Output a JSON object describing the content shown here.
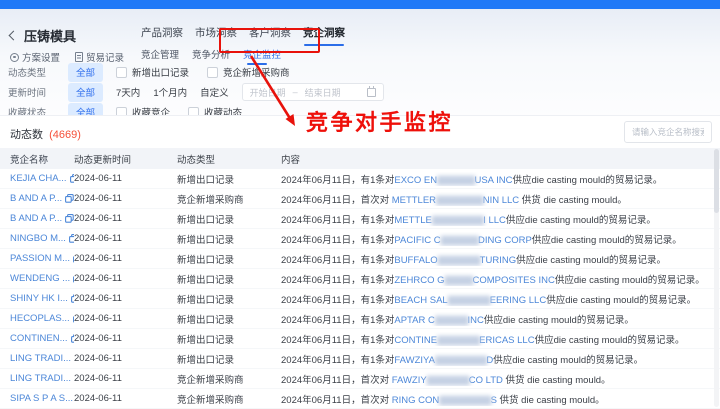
{
  "colors": {
    "accent_blue": "#2079f7",
    "tab_blue": "#2b6de8",
    "annotation_red": "#e8120b",
    "count_orange": "#f5503a",
    "link_blue": "#4c87d8",
    "pill_bg": "#dcebff"
  },
  "header": {
    "title": "压铸模具",
    "actions": [
      {
        "icon": "gear-icon",
        "label": "方案设置"
      },
      {
        "icon": "document-icon",
        "label": "贸易记录"
      }
    ],
    "tabs": [
      {
        "label": "产品洞察"
      },
      {
        "label": "市场洞察"
      },
      {
        "label": "客户洞察"
      },
      {
        "label": "竞企洞察"
      }
    ],
    "subtabs": [
      {
        "label": "竞企管理"
      },
      {
        "label": "竞争分析"
      },
      {
        "label": "竞企监控"
      }
    ]
  },
  "annotation": {
    "label": "竞争对手监控"
  },
  "filters": [
    {
      "label": "动态类型",
      "all": "全部",
      "checkboxes": [
        "新增出口记录",
        "竞企新增采购商"
      ]
    },
    {
      "label": "更新时间",
      "all": "全部",
      "options": [
        "7天内",
        "1个月内",
        "自定义"
      ],
      "date_start": "开始日期",
      "date_sep": "–",
      "date_end": "结束日期"
    },
    {
      "label": "收藏状态",
      "all": "全部",
      "checkboxes": [
        "收藏竞企",
        "收藏动态"
      ]
    }
  ],
  "list": {
    "count_label": "动态数",
    "count": "(4669)",
    "search_placeholder": "请输入竞企名称搜索",
    "columns": [
      "竞企名称",
      "动态更新时间",
      "动态类型",
      "内容"
    ],
    "rows": [
      {
        "name": "KEJIA CHA...",
        "time": "2024-06-11",
        "type": "新增出口记录",
        "parts": [
          {
            "t": "ctext",
            "v": "2024年06月11日，有1条对"
          },
          {
            "t": "clink",
            "v": "EXCO EN"
          },
          {
            "t": "cblur",
            "v": "████████"
          },
          {
            "t": "clink",
            "v": "USA INC"
          },
          {
            "t": "ctext",
            "v": "供应die casting mould的贸易记录。"
          }
        ]
      },
      {
        "name": "B AND A P...",
        "time": "2024-06-11",
        "type": "竞企新增采购商",
        "parts": [
          {
            "t": "ctext",
            "v": "2024年06月11日，首次对 "
          },
          {
            "t": "clink",
            "v": "METTLER"
          },
          {
            "t": "cblur",
            "v": "██████████"
          },
          {
            "t": "clink",
            "v": "NIN LLC"
          },
          {
            "t": "ctext",
            "v": " 供货 die casting mould。"
          }
        ]
      },
      {
        "name": "B AND A P...",
        "time": "2024-06-11",
        "type": "新增出口记录",
        "parts": [
          {
            "t": "ctext",
            "v": "2024年06月11日，有1条对"
          },
          {
            "t": "clink",
            "v": "METTLE"
          },
          {
            "t": "cblur",
            "v": "███████████"
          },
          {
            "t": "clink",
            "v": "I LLC"
          },
          {
            "t": "ctext",
            "v": "供应die casting mould的贸易记录。"
          }
        ]
      },
      {
        "name": "NINGBO M...",
        "time": "2024-06-11",
        "type": "新增出口记录",
        "parts": [
          {
            "t": "ctext",
            "v": "2024年06月11日，有1条对"
          },
          {
            "t": "clink",
            "v": "PACIFIC C"
          },
          {
            "t": "cblur",
            "v": "████████"
          },
          {
            "t": "clink",
            "v": "DING CORP"
          },
          {
            "t": "ctext",
            "v": "供应die casting mould的贸易记录。"
          }
        ]
      },
      {
        "name": "PASSION M...",
        "time": "2024-06-11",
        "type": "新增出口记录",
        "parts": [
          {
            "t": "ctext",
            "v": "2024年06月11日，有1条对"
          },
          {
            "t": "clink",
            "v": "BUFFALO"
          },
          {
            "t": "cblur",
            "v": "█████████"
          },
          {
            "t": "clink",
            "v": "TURING"
          },
          {
            "t": "ctext",
            "v": "供应die casting mould的贸易记录。"
          }
        ]
      },
      {
        "name": "WENDENG ...",
        "time": "2024-06-11",
        "type": "新增出口记录",
        "parts": [
          {
            "t": "ctext",
            "v": "2024年06月11日，有1条对"
          },
          {
            "t": "clink",
            "v": "ZEHRCO G"
          },
          {
            "t": "cblur",
            "v": "██████"
          },
          {
            "t": "clink",
            "v": "COMPOSITES INC"
          },
          {
            "t": "ctext",
            "v": "供应die casting mould的贸易记录。"
          }
        ]
      },
      {
        "name": "SHINY HK I...",
        "time": "2024-06-11",
        "type": "新增出口记录",
        "parts": [
          {
            "t": "ctext",
            "v": "2024年06月11日，有1条对"
          },
          {
            "t": "clink",
            "v": "BEACH SAL"
          },
          {
            "t": "cblur",
            "v": "█████████"
          },
          {
            "t": "clink",
            "v": "EERING LLC"
          },
          {
            "t": "ctext",
            "v": "供应die casting mould的贸易记录。"
          }
        ]
      },
      {
        "name": "HECOPLAS...",
        "time": "2024-06-11",
        "type": "新增出口记录",
        "parts": [
          {
            "t": "ctext",
            "v": "2024年06月11日，有1条对"
          },
          {
            "t": "clink",
            "v": "APTAR C"
          },
          {
            "t": "cblur",
            "v": "███████"
          },
          {
            "t": "clink",
            "v": "INC"
          },
          {
            "t": "ctext",
            "v": "供应die casting mould的贸易记录。"
          }
        ]
      },
      {
        "name": "CONTINEN...",
        "time": "2024-06-11",
        "type": "新增出口记录",
        "parts": [
          {
            "t": "ctext",
            "v": "2024年06月11日，有1条对"
          },
          {
            "t": "clink",
            "v": "CONTINE"
          },
          {
            "t": "cblur",
            "v": "█████████"
          },
          {
            "t": "clink",
            "v": "ERICAS LLC"
          },
          {
            "t": "ctext",
            "v": "供应die casting mould的贸易记录。"
          }
        ]
      },
      {
        "name": "LING TRADI...",
        "time": "2024-06-11",
        "type": "新增出口记录",
        "parts": [
          {
            "t": "ctext",
            "v": "2024年06月11日，有1条对"
          },
          {
            "t": "clink",
            "v": "FAWZIYA"
          },
          {
            "t": "cblur",
            "v": "███████████"
          },
          {
            "t": "clink",
            "v": "D"
          },
          {
            "t": "ctext",
            "v": "供应die casting mould的贸易记录。"
          }
        ]
      },
      {
        "name": "LING TRADI...",
        "time": "2024-06-11",
        "type": "竞企新增采购商",
        "parts": [
          {
            "t": "ctext",
            "v": "2024年06月11日，首次对 "
          },
          {
            "t": "clink",
            "v": "FAWZIY"
          },
          {
            "t": "cblur",
            "v": "█████████"
          },
          {
            "t": "clink",
            "v": "CO LTD"
          },
          {
            "t": "ctext",
            "v": " 供货 die casting mould。"
          }
        ]
      },
      {
        "name": "SIPA S P A S...",
        "time": "2024-06-11",
        "type": "竞企新增采购商",
        "parts": [
          {
            "t": "ctext",
            "v": "2024年06月11日，首次对 "
          },
          {
            "t": "clink",
            "v": "RING CON"
          },
          {
            "t": "cblur",
            "v": "███████████"
          },
          {
            "t": "clink",
            "v": "S"
          },
          {
            "t": "ctext",
            "v": " 供货 die casting mould。"
          }
        ]
      }
    ]
  }
}
